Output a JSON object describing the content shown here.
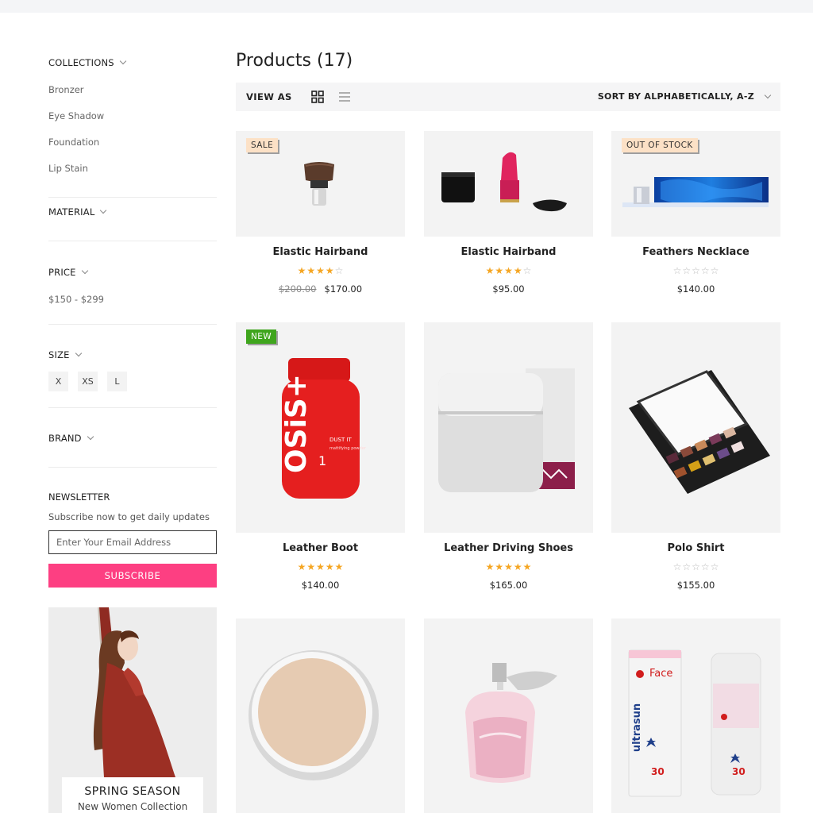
{
  "sidebar": {
    "collections": {
      "title": "COLLECTIONS",
      "items": [
        "Bronzer",
        "Eye Shadow",
        "Foundation",
        "Lip Stain"
      ]
    },
    "material": {
      "title": "MATERIAL"
    },
    "price": {
      "title": "PRICE",
      "range": "$150 - $299"
    },
    "size": {
      "title": "SIZE",
      "options": [
        "X",
        "XS",
        "L"
      ]
    },
    "brand": {
      "title": "BRAND"
    },
    "newsletter": {
      "title": "NEWSLETTER",
      "description": "Subscribe now to get daily updates",
      "placeholder": "Enter Your Email Address",
      "button": "SUBSCRIBE"
    },
    "promo": {
      "title": "SPRING SEASON",
      "subtitle": "New Women Collection"
    }
  },
  "main": {
    "title": "Products (17)",
    "toolbar": {
      "view_as": "VIEW AS",
      "sort": "SORT BY ALPHABETICALLY, A-Z"
    },
    "products": [
      {
        "name": "Elastic Hairband",
        "badge": "SALE",
        "rating": 4,
        "old_price": "$200.00",
        "price": "$170.00",
        "image": "brush"
      },
      {
        "name": "Elastic Hairband",
        "badge": "",
        "rating": 4,
        "old_price": "",
        "price": "$95.00",
        "image": "lipstick"
      },
      {
        "name": "Feathers Necklace",
        "badge": "OUT OF STOCK",
        "rating": 0,
        "old_price": "",
        "price": "$140.00",
        "image": "bluebox"
      },
      {
        "name": "Leather Boot",
        "badge": "NEW",
        "rating": 5,
        "old_price": "",
        "price": "$140.00",
        "image": "osis"
      },
      {
        "name": "Leather Driving Shoes",
        "badge": "",
        "rating": 5,
        "old_price": "",
        "price": "$165.00",
        "image": "jar"
      },
      {
        "name": "Polo Shirt",
        "badge": "",
        "rating": 0,
        "old_price": "",
        "price": "$155.00",
        "image": "palette"
      },
      {
        "name": "",
        "badge": "",
        "rating": null,
        "old_price": "",
        "price": "",
        "image": "powder"
      },
      {
        "name": "",
        "badge": "",
        "rating": null,
        "old_price": "",
        "price": "",
        "image": "perfume"
      },
      {
        "name": "",
        "badge": "",
        "rating": null,
        "old_price": "",
        "price": "",
        "image": "ultrasun"
      }
    ]
  },
  "ultrasun": {
    "brand": "ultrasun",
    "label": "Face",
    "spf": "30"
  },
  "colors": {
    "accent": "#fd3f82",
    "star": "#f5a623",
    "new_badge": "#3fa51d",
    "sale_badge": "#fce1c6"
  }
}
